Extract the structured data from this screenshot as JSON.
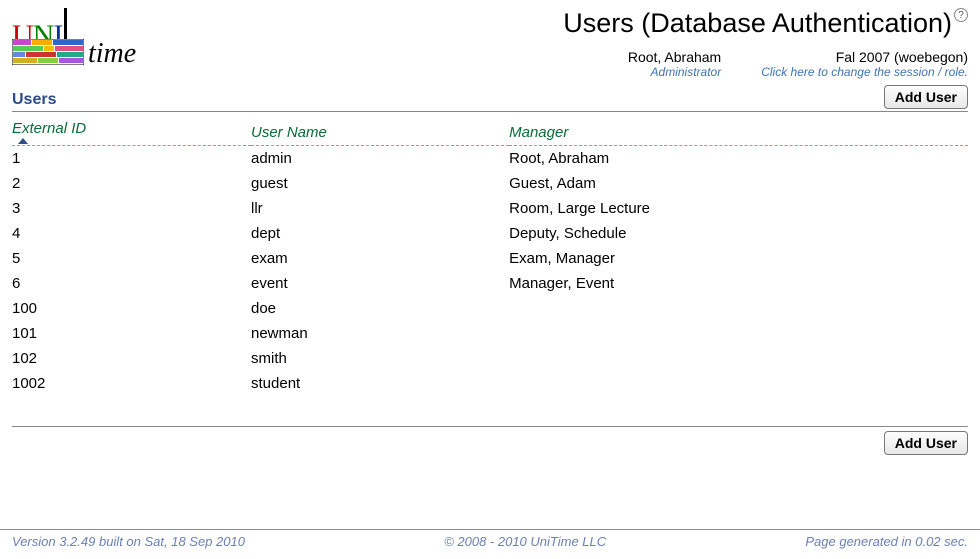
{
  "header": {
    "logo_u": "U",
    "logo_n": "N",
    "logo_i": "I",
    "logo_time": "time",
    "title": "Users (Database Authentication)",
    "user_name": "Root, Abraham",
    "user_role": "Administrator",
    "session": "Fal 2007 (woebegon)",
    "session_hint": "Click here to change the session / role."
  },
  "section": {
    "title": "Users",
    "add_button": "Add User"
  },
  "columns": {
    "external_id": "External ID",
    "user_name": "User Name",
    "manager": "Manager"
  },
  "rows": [
    {
      "id": "1",
      "user": "admin",
      "manager": "Root, Abraham"
    },
    {
      "id": "2",
      "user": "guest",
      "manager": "Guest, Adam"
    },
    {
      "id": "3",
      "user": "llr",
      "manager": "Room, Large Lecture"
    },
    {
      "id": "4",
      "user": "dept",
      "manager": "Deputy, Schedule"
    },
    {
      "id": "5",
      "user": "exam",
      "manager": "Exam, Manager"
    },
    {
      "id": "6",
      "user": "event",
      "manager": "Manager, Event"
    },
    {
      "id": "100",
      "user": "doe",
      "manager": ""
    },
    {
      "id": "101",
      "user": "newman",
      "manager": ""
    },
    {
      "id": "102",
      "user": "smith",
      "manager": ""
    },
    {
      "id": "1002",
      "user": "student",
      "manager": ""
    }
  ],
  "footer": {
    "version": "Version 3.2.49 built on Sat, 18 Sep 2010",
    "copyright": "© 2008 - 2010 UniTime LLC",
    "timing": "Page generated in 0.02 sec."
  }
}
